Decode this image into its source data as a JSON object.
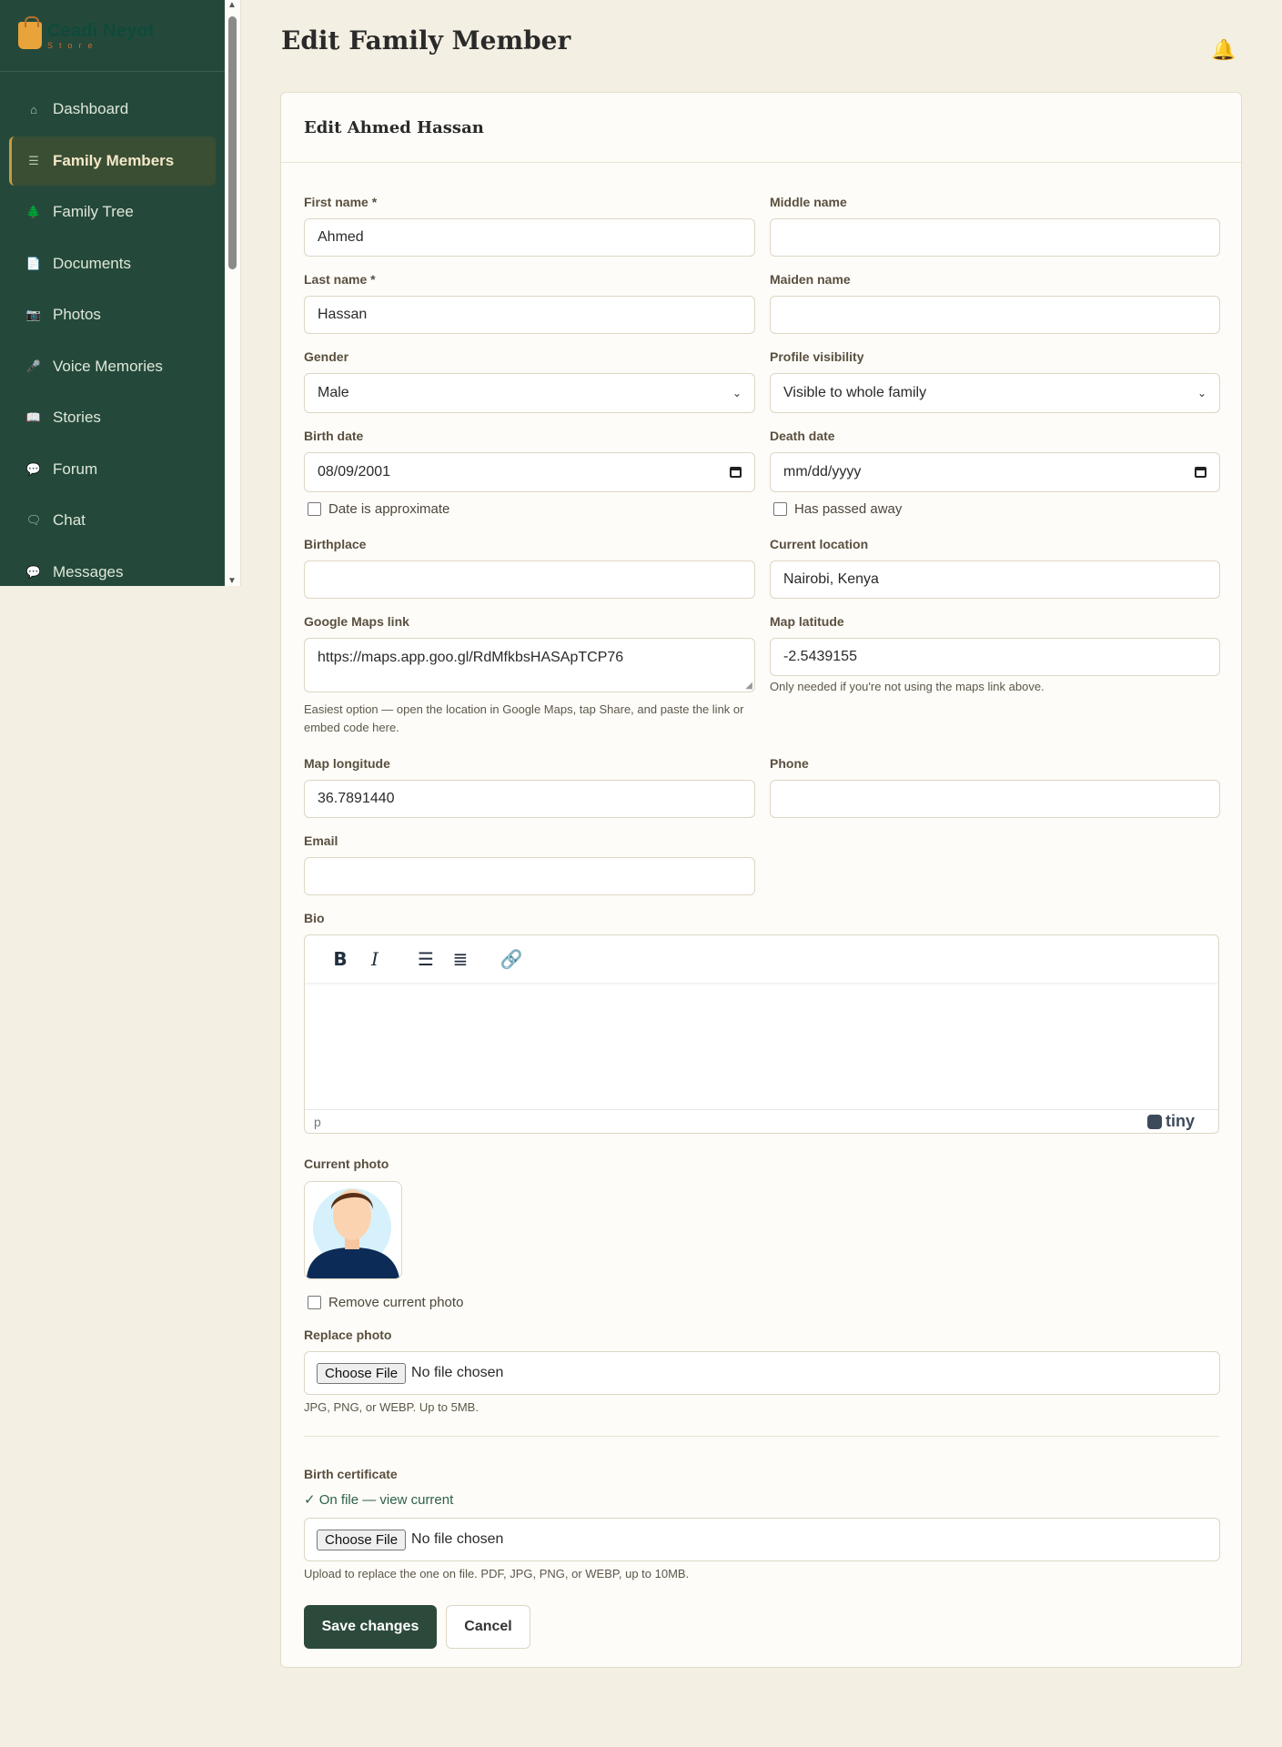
{
  "brand": {
    "name": "Ceadi Neyot",
    "sub": "Store"
  },
  "sidebar": {
    "items": [
      {
        "label": "Dashboard",
        "icon": "⌂"
      },
      {
        "label": "Family Members",
        "icon": "☰"
      },
      {
        "label": "Family Tree",
        "icon": "🌲"
      },
      {
        "label": "Documents",
        "icon": "📄"
      },
      {
        "label": "Photos",
        "icon": "📷"
      },
      {
        "label": "Voice Memories",
        "icon": "🎤"
      },
      {
        "label": "Stories",
        "icon": "📖"
      },
      {
        "label": "Forum",
        "icon": "💬"
      },
      {
        "label": "Chat",
        "icon": "🗨"
      },
      {
        "label": "Messages",
        "icon": "💬"
      }
    ],
    "active_index": 1
  },
  "page": {
    "title": "Edit Family Member",
    "bell_icon": "🔔"
  },
  "card": {
    "title": "Edit Ahmed Hassan"
  },
  "form": {
    "first_name": {
      "label": "First name *",
      "value": "Ahmed"
    },
    "middle_name": {
      "label": "Middle name",
      "value": ""
    },
    "last_name": {
      "label": "Last name *",
      "value": "Hassan"
    },
    "maiden_name": {
      "label": "Maiden name",
      "value": ""
    },
    "gender": {
      "label": "Gender",
      "value": "Male"
    },
    "visibility": {
      "label": "Profile visibility",
      "value": "Visible to whole family"
    },
    "birth_date": {
      "label": "Birth date",
      "value": "08/09/2001"
    },
    "death_date": {
      "label": "Death date",
      "value": "mm/dd/yyyy"
    },
    "date_approx": {
      "label": "Date is approximate"
    },
    "passed_away": {
      "label": "Has passed away"
    },
    "birthplace": {
      "label": "Birthplace",
      "value": ""
    },
    "current_location": {
      "label": "Current location",
      "value": "Nairobi, Kenya"
    },
    "maps_link": {
      "label": "Google Maps link",
      "value": "https://maps.app.goo.gl/RdMfkbsHASApTCP76",
      "help": "Easiest option — open the location in Google Maps, tap Share, and paste the link or embed code here."
    },
    "map_latitude": {
      "label": "Map latitude",
      "value": "-2.5439155",
      "help": "Only needed if you're not using the maps link above."
    },
    "map_longitude": {
      "label": "Map longitude",
      "value": "36.7891440"
    },
    "phone": {
      "label": "Phone",
      "value": ""
    },
    "email": {
      "label": "Email",
      "value": ""
    },
    "bio": {
      "label": "Bio",
      "status_path": "p",
      "brand": "tiny"
    },
    "current_photo": {
      "label": "Current photo"
    },
    "remove_photo": {
      "label": "Remove current photo"
    },
    "replace_photo": {
      "label": "Replace photo",
      "button": "Choose File",
      "status": "No file chosen",
      "help": "JPG, PNG, or WEBP. Up to 5MB."
    },
    "birth_certificate": {
      "label": "Birth certificate",
      "on_file": "✓ On file — view current",
      "button": "Choose File",
      "status": "No file chosen",
      "help": "Upload to replace the one on file. PDF, JPG, PNG, or WEBP, up to 10MB."
    }
  },
  "actions": {
    "save": "Save changes",
    "cancel": "Cancel"
  }
}
